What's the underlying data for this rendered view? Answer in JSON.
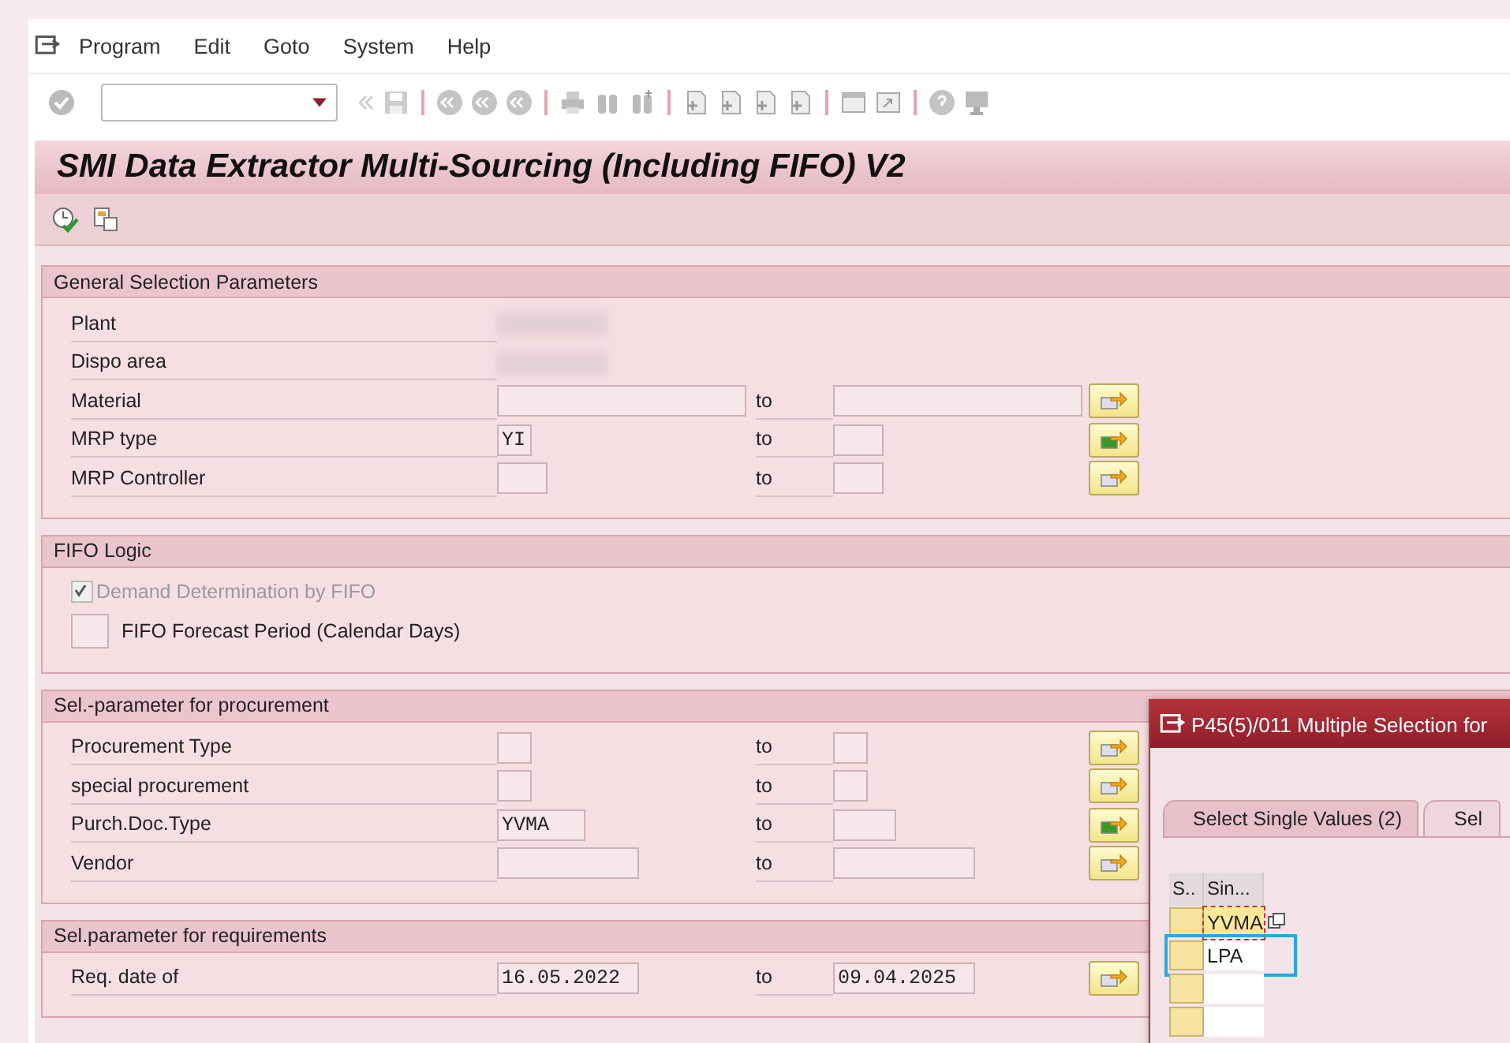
{
  "menu": [
    {
      "label": "Program"
    },
    {
      "label": "Edit"
    },
    {
      "label": "Goto"
    },
    {
      "label": "System"
    },
    {
      "label": "Help"
    }
  ],
  "screen_title": "SMI Data Extractor Multi-Sourcing (Including FIFO) V2",
  "groups": [
    {
      "title": "General Selection Parameters",
      "rows": [
        {
          "kind": "redacted",
          "label": "Plant"
        },
        {
          "kind": "redacted",
          "label": "Dispo area"
        },
        {
          "kind": "range",
          "label": "Material",
          "to": "to",
          "multi_active": false
        },
        {
          "kind": "range",
          "label": "MRP type",
          "low": "YI",
          "to": "to",
          "multi_active": true
        },
        {
          "kind": "range",
          "label": "MRP Controller",
          "to": "to",
          "multi_active": false
        }
      ]
    },
    {
      "title": "FIFO Logic",
      "rows": [
        {
          "kind": "checkbox",
          "label": "Demand Determination by FIFO",
          "checked": true,
          "disabled": true
        },
        {
          "kind": "parameter",
          "label": "FIFO Forecast Period (Calendar Days)"
        }
      ]
    },
    {
      "title": "Sel.-parameter for procurement",
      "rows": [
        {
          "kind": "range",
          "label": "Procurement Type",
          "to": "to",
          "multi_active": false
        },
        {
          "kind": "range",
          "label": "special procurement",
          "to": "to",
          "multi_active": false
        },
        {
          "kind": "range",
          "label": "Purch.Doc.Type",
          "low": "YVMA",
          "to": "to",
          "multi_active": true
        },
        {
          "kind": "range",
          "label": "Vendor",
          "to": "to",
          "multi_active": false
        }
      ]
    },
    {
      "title": "Sel.parameter for requirements",
      "rows": [
        {
          "kind": "range",
          "label": "Req. date of",
          "low": "16.05.2022",
          "to": "to",
          "high": "09.04.2025",
          "multi_active": false
        }
      ]
    }
  ],
  "popup": {
    "title": "P45(5)/011 Multiple Selection for",
    "tabs": [
      {
        "label": "Select Single Values (2)",
        "selected": true
      },
      {
        "label": "Sel",
        "selected": false
      }
    ],
    "columns": [
      "S..",
      "Sin..."
    ],
    "rows": [
      {
        "value": "YVMA",
        "current": true,
        "highlighted": false
      },
      {
        "value": "LPA",
        "current": false,
        "highlighted": true
      },
      {
        "current": false,
        "highlighted": false
      },
      {
        "current": false,
        "highlighted": false
      }
    ]
  }
}
